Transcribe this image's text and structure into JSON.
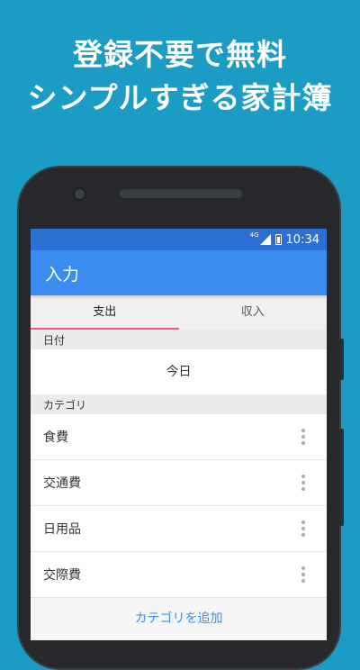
{
  "promo": {
    "line1": "登録不要で無料",
    "line2": "シンプルすぎる家計簿"
  },
  "status_bar": {
    "network": "4G",
    "time": "10:34"
  },
  "app_bar": {
    "title": "入力"
  },
  "tabs": [
    {
      "label": "支出",
      "selected": true
    },
    {
      "label": "収入",
      "selected": false
    }
  ],
  "date_section": {
    "header": "日付",
    "value": "今日"
  },
  "category_section": {
    "header": "カテゴリ",
    "items": [
      {
        "label": "食費"
      },
      {
        "label": "交通費"
      },
      {
        "label": "日用品"
      },
      {
        "label": "交際費"
      }
    ],
    "add_label": "カテゴリを追加"
  },
  "colors": {
    "background": "#1a9cc4",
    "app_bar": "#3b8cf0",
    "status_bar": "#2d6fd2",
    "tab_indicator": "#f05a87",
    "link": "#3b8cf0"
  },
  "icons": {
    "menu_more": "more-vert-icon",
    "signal": "signal-icon",
    "battery": "battery-icon"
  }
}
